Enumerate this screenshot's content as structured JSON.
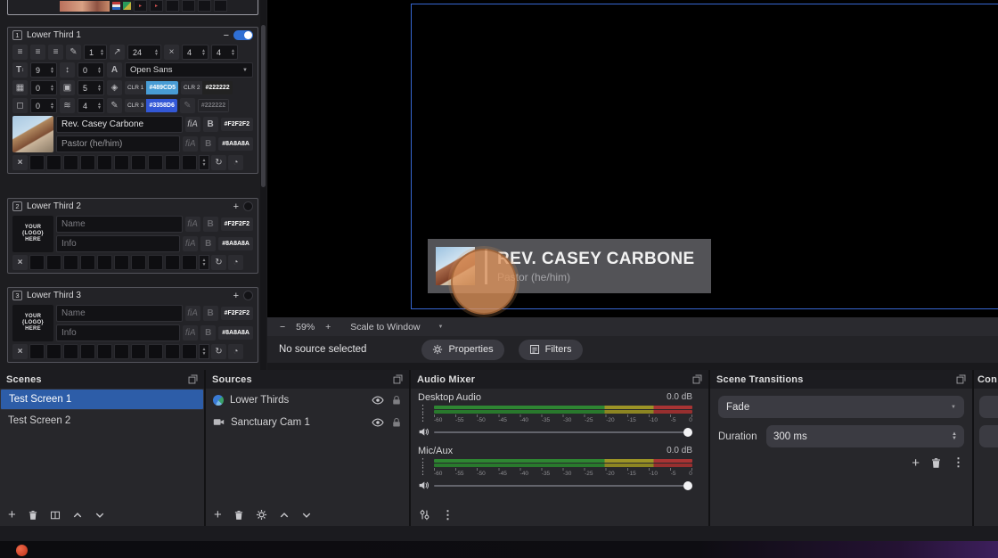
{
  "left_panel": {
    "sections": [
      {
        "badge": "1",
        "title": "Lower Third 1",
        "header_action": "−",
        "spin_outline": "1",
        "spin_size": "24",
        "spin_a": "4",
        "spin_b": "4",
        "spin_lineheight": "9",
        "spin_spacing": "0",
        "font_name": "Open Sans",
        "spin_logo": "0",
        "spin_copies": "5",
        "clr1_label": "CLR 1",
        "clr1_hex": "#489CD5",
        "clr2_label": "CLR 2",
        "clr2_hex": "#222222",
        "spin_corner": "0",
        "spin_border": "4",
        "clr3_label": "CLR 3",
        "clr3_hex": "#3358D6",
        "clr4_hex": "#222222",
        "name_value": "Rev. Casey Carbone",
        "name_color_hex": "#F2F2F2",
        "info_value": "Pastor (he/him)",
        "info_color_hex": "#8A8A8A"
      },
      {
        "badge": "2",
        "title": "Lower Third 2",
        "header_action": "+",
        "logo_lines": [
          "YOUR",
          "{LOGO}",
          "HERE"
        ],
        "name_placeholder": "Name",
        "name_color_hex": "#F2F2F2",
        "info_placeholder": "Info",
        "info_color_hex": "#8A8A8A"
      },
      {
        "badge": "3",
        "title": "Lower Third 3",
        "header_action": "+",
        "logo_lines": [
          "YOUR",
          "{LOGO}",
          "HERE"
        ],
        "name_placeholder": "Name",
        "name_color_hex": "#F2F2F2",
        "info_placeholder": "Info",
        "info_color_hex": "#8A8A8A"
      }
    ]
  },
  "preview": {
    "lower_third_title": "REV. CASEY CARBONE",
    "lower_third_subtitle": "Pastor (he/him)"
  },
  "zoom_bar": {
    "minus": "−",
    "level": "59%",
    "plus": "+",
    "mode": "Scale to Window"
  },
  "source_bar": {
    "status": "No source selected",
    "properties_label": "Properties",
    "filters_label": "Filters"
  },
  "scenes_dock": {
    "title": "Scenes",
    "items": [
      "Test Screen 1",
      "Test Screen 2"
    ]
  },
  "sources_dock": {
    "title": "Sources",
    "rows": [
      {
        "label": "Lower Thirds"
      },
      {
        "label": "Sanctuary Cam 1"
      }
    ]
  },
  "audio_dock": {
    "title": "Audio Mixer",
    "channels": [
      {
        "name": "Desktop Audio",
        "level": "0.0 dB"
      },
      {
        "name": "Mic/Aux",
        "level": "0.0 dB"
      }
    ],
    "tick_labels": [
      "-60",
      "-55",
      "-50",
      "-45",
      "-40",
      "-35",
      "-30",
      "-25",
      "-20",
      "-15",
      "-10",
      "-5",
      "0"
    ]
  },
  "transitions_dock": {
    "title": "Scene Transitions",
    "current_transition": "Fade",
    "duration_label": "Duration",
    "duration_value": "300 ms"
  },
  "controls_dock": {
    "title": "Con"
  }
}
